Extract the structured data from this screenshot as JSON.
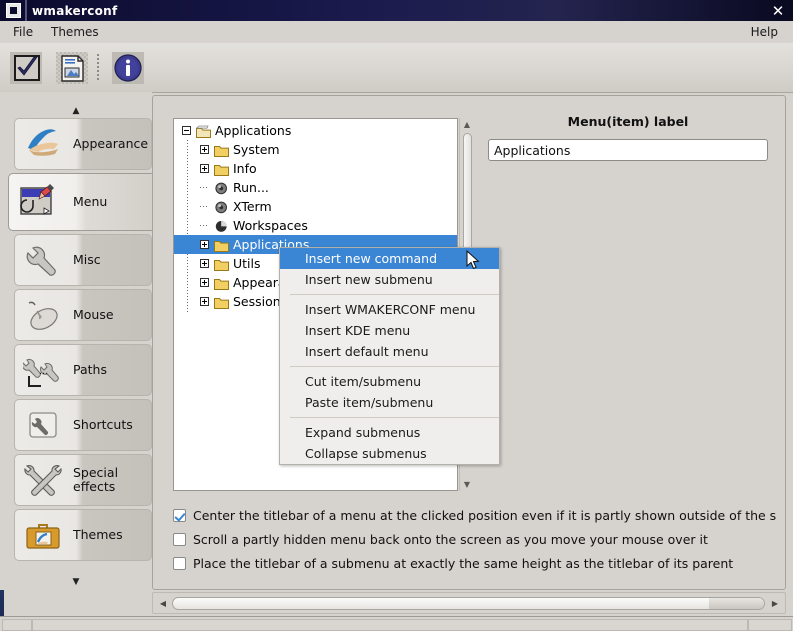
{
  "window": {
    "title": "wmakerconf",
    "close_label": "✕",
    "menu_icon": "window-menu-icon"
  },
  "menubar": {
    "items": [
      {
        "label": "File",
        "name": "menu-file"
      },
      {
        "label": "Themes",
        "name": "menu-themes"
      }
    ],
    "help": {
      "label": "Help",
      "name": "menu-help"
    }
  },
  "toolbar": {
    "buttons": [
      {
        "name": "apply-button",
        "icon": "checkmark-icon"
      },
      {
        "name": "save-button",
        "icon": "document-save-icon"
      },
      {
        "name": "about-button",
        "icon": "info-icon"
      }
    ]
  },
  "sidebar": {
    "scroll_up": "▲",
    "scroll_down": "▼",
    "items": [
      {
        "label": "Appearance",
        "icon": "appearance-icon",
        "selected": false
      },
      {
        "label": "Menu",
        "icon": "menu-edit-icon",
        "selected": true
      },
      {
        "label": "Misc",
        "icon": "wrench-icon",
        "selected": false
      },
      {
        "label": "Mouse",
        "icon": "mouse-icon",
        "selected": false
      },
      {
        "label": "Paths",
        "icon": "paths-icon",
        "selected": false
      },
      {
        "label": "Shortcuts",
        "icon": "shortcuts-icon",
        "selected": false
      },
      {
        "label": "Special effects",
        "icon": "special-effects-icon",
        "selected": false
      },
      {
        "label": "Themes",
        "icon": "themes-briefcase-icon",
        "selected": false
      }
    ]
  },
  "tree": {
    "rows": [
      {
        "label": "Applications",
        "indent": 0,
        "toggle": "minus",
        "icon": "open-folder-icon",
        "selected": false
      },
      {
        "label": "System",
        "indent": 1,
        "toggle": "plus",
        "icon": "folder-icon",
        "selected": false
      },
      {
        "label": "Info",
        "indent": 1,
        "toggle": "plus",
        "icon": "folder-icon",
        "selected": false
      },
      {
        "label": "Run...",
        "indent": 1,
        "toggle": "none",
        "icon": "gear-icon",
        "selected": false
      },
      {
        "label": "XTerm",
        "indent": 1,
        "toggle": "none",
        "icon": "gear-icon",
        "selected": false
      },
      {
        "label": "Workspaces",
        "indent": 1,
        "toggle": "none",
        "icon": "pie-icon",
        "selected": false
      },
      {
        "label": "Applications",
        "indent": 1,
        "toggle": "plus",
        "icon": "folder-icon",
        "selected": true
      },
      {
        "label": "Utils",
        "indent": 1,
        "toggle": "plus",
        "icon": "folder-icon",
        "selected": false
      },
      {
        "label": "Appearance",
        "indent": 1,
        "toggle": "plus",
        "icon": "folder-icon",
        "selected": false
      },
      {
        "label": "Session",
        "indent": 1,
        "toggle": "plus",
        "icon": "folder-icon",
        "selected": false
      }
    ],
    "scrollbar": {
      "up": "▲",
      "down": "▼"
    }
  },
  "context_menu": {
    "items": [
      {
        "label": "Insert new command",
        "highlighted": true,
        "name": "ctx-insert-new-command"
      },
      {
        "label": "Insert new submenu",
        "highlighted": false,
        "name": "ctx-insert-new-submenu"
      },
      {
        "separator": true
      },
      {
        "label": "Insert WMAKERCONF menu",
        "highlighted": false,
        "name": "ctx-insert-wmakerconf-menu"
      },
      {
        "label": "Insert KDE menu",
        "highlighted": false,
        "name": "ctx-insert-kde-menu"
      },
      {
        "label": "Insert default menu",
        "highlighted": false,
        "name": "ctx-insert-default-menu"
      },
      {
        "separator": true
      },
      {
        "label": "Cut item/submenu",
        "highlighted": false,
        "name": "ctx-cut-item-submenu"
      },
      {
        "label": "Paste item/submenu",
        "highlighted": false,
        "name": "ctx-paste-item-submenu"
      },
      {
        "separator": true
      },
      {
        "label": "Expand submenus",
        "highlighted": false,
        "name": "ctx-expand-submenus"
      },
      {
        "label": "Collapse submenus",
        "highlighted": false,
        "name": "ctx-collapse-submenus"
      }
    ]
  },
  "right_panel": {
    "label": "Menu(item) label",
    "input_value": "Applications",
    "input_placeholder": ""
  },
  "options": [
    {
      "label": "Center the titlebar of a menu at the clicked position even if it is partly shown outside of the s",
      "checked": true,
      "name": "option-center-titlebar"
    },
    {
      "label": "Scroll a partly hidden menu back onto the screen as you move your mouse over it",
      "checked": false,
      "name": "option-scroll-hidden-menu"
    },
    {
      "label": "Place the titlebar of a submenu at exactly the same height as the titlebar of its parent",
      "checked": false,
      "name": "option-submenu-same-height"
    }
  ],
  "hscroll": {
    "left": "◀",
    "right": "▶"
  },
  "colors": {
    "titlebar_start": "#0b0b2e",
    "titlebar_end": "#090920",
    "selection": "#3b86d4",
    "face": "#d6d3ce",
    "folder": "#f2cf63"
  }
}
